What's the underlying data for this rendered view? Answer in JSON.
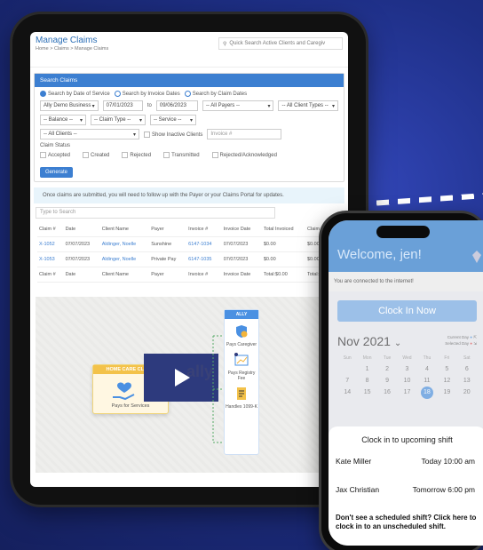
{
  "tablet": {
    "title": "Manage Claims",
    "breadcrumb": "Home > Claims > Manage Claims",
    "quick_search_placeholder": "Quick Search Active Clients and Caregiv",
    "panel_title": "Search Claims",
    "radios": [
      "Search by Date of Service",
      "Search by Invoice Dates",
      "Search by Claim Dates"
    ],
    "business": "Ally Demo Business",
    "date_from": "07/01/2023",
    "to_label": "to",
    "date_to": "09/06/2023",
    "payers": "-- All Payers --",
    "client_types": "-- All Client Types --",
    "balance": "-- Balance --",
    "claim_type": "-- Claim Type --",
    "service": "-- Service --",
    "all_clients": "-- All Clients --",
    "inactive_label": "Show Inactive Clients",
    "invoice_placeholder": "Invoice #",
    "status_label": "Claim Status",
    "statuses": [
      "Accepted",
      "Created",
      "Rejected",
      "Transmitted",
      "Rejected/Acknowledged"
    ],
    "generate": "Generate",
    "notice": "Once claims are submitted, you will need to follow up with the Payer or your Claims Portal for updates.",
    "table_search_placeholder": "Type to Search",
    "columns": [
      "Claim #",
      "Date",
      "Client Name",
      "Payer",
      "Invoice #",
      "Invoice Date",
      "Total Invoiced",
      "Claim Amt"
    ],
    "rows": [
      [
        "X-1052",
        "07/07/2023",
        "Aldinger, Noelle",
        "Sunshine",
        "6147-1034",
        "07/07/2023",
        "$0.00",
        "$0.00"
      ],
      [
        "X-1053",
        "07/07/2023",
        "Aldinger, Noelle",
        "Private Pay",
        "6147-1035",
        "07/07/2023",
        "$0.00",
        "$0.00"
      ]
    ],
    "footer": [
      "Claim #",
      "Date",
      "Client Name",
      "Payer",
      "Invoice #",
      "Invoice Date",
      "Total:$0.00",
      "Total:$"
    ],
    "video": {
      "hcc_tag": "HOME CARE CLIENT",
      "hcc_label": "Pays for Services",
      "ally_head": "ALLY",
      "ally_items": [
        "Pays Caregiver",
        "Pays Registry Fee",
        "Handles 1099-K"
      ],
      "watermark": "ally"
    }
  },
  "phone": {
    "welcome": "Welcome, jen!",
    "connected": "You are connected to the internet!",
    "clock_in": "Clock In Now",
    "month": "Nov 2021",
    "legend_current": "Current Day",
    "legend_selected": "Selected Day",
    "day_names": [
      "Sun",
      "Mon",
      "Tue",
      "Wed",
      "Thu",
      "Fri",
      "Sat"
    ],
    "week1": [
      "",
      "1",
      "2",
      "3",
      "4",
      "5",
      "6"
    ],
    "week2": [
      "7",
      "8",
      "9",
      "10",
      "11",
      "12",
      "13"
    ],
    "week3": [
      "14",
      "15",
      "16",
      "17",
      "18",
      "19",
      "20"
    ],
    "sheet_title": "Clock in to upcoming shift",
    "shifts": [
      {
        "name": "Kate Miller",
        "time": "Today 10:00 am"
      },
      {
        "name": "Jax Christian",
        "time": "Tomorrow 6:00 pm"
      }
    ],
    "unscheduled": "Don't see a scheduled shift? Click here to clock in to an unscheduled shift."
  }
}
